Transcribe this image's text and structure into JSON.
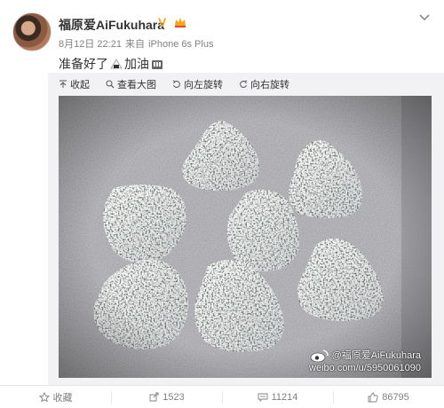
{
  "post": {
    "username": "福原爱AiFukuhara",
    "date": "8月12日 22:21",
    "source_prefix": "来自",
    "source": "iPhone 6s Plus",
    "text_before": "准备好了",
    "text_after": "加油"
  },
  "toolbar": {
    "collapse": "收起",
    "view_large": "查看大图",
    "rotate_left": "向左旋转",
    "rotate_right": "向右旋转"
  },
  "watermark": {
    "handle": "@福原爱AiFukuhara",
    "url": "weibo.com/u/5950061090"
  },
  "actions": {
    "favorite": "收藏",
    "repost_count": "1523",
    "comment_count": "11214",
    "like_count": "86795"
  },
  "colors": {
    "verified_badge": "#f7a51c",
    "text_primary": "#333333",
    "text_meta": "#808080"
  }
}
